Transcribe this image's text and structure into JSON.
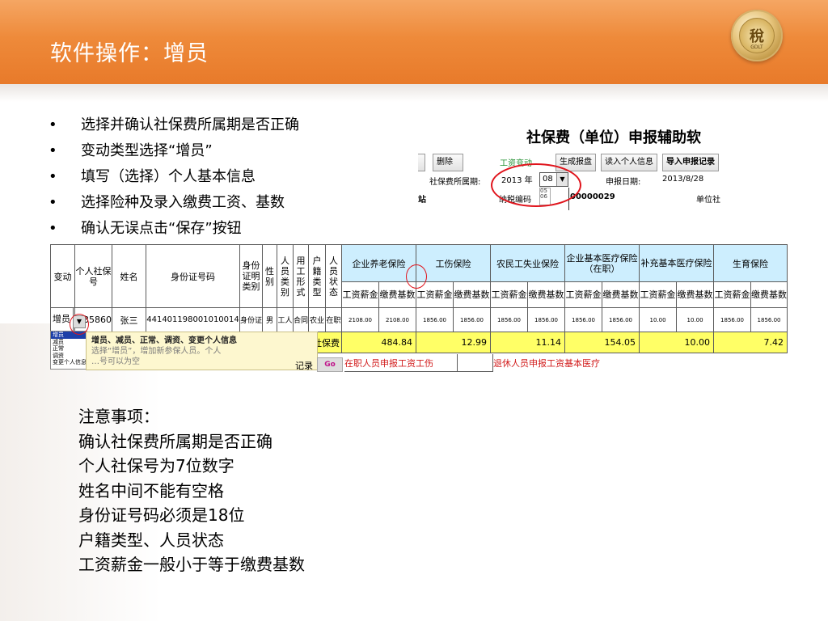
{
  "slide": {
    "title": "软件操作：增员"
  },
  "logo": {
    "glyph": "稅",
    "text": "GDLT"
  },
  "bullets": [
    "选择并确认社保费所属期是否正确",
    "变动类型选择“增员”",
    "填写（选择）个人基本信息",
    "选择险种及录入缴费工资、基数",
    "确认无误点击“保存”按钮"
  ],
  "bullet_marker": "•",
  "form_shot": {
    "title": "社保费（单位）申报辅助软",
    "delete_button": "删除",
    "wage_change": "工资变动",
    "generate_button": "生成报盘",
    "read_button": "读入个人信息",
    "import_button": "导入申报记录",
    "period_label": "社保费所属期:",
    "year": "2013 年",
    "month": "08",
    "month_options": [
      "05",
      "06"
    ],
    "report_date_label": "申报日期:",
    "report_date": "2013/8/28",
    "left_cut": "站",
    "tax_code_label": "纳税编码",
    "tax_code_value": "00000029",
    "unit_label": "单位社"
  },
  "table": {
    "headers": {
      "change": "变动",
      "personal_no": "个人社保号",
      "name": "姓名",
      "id_no": "身份证号码",
      "id_type": "身份证明类别",
      "gender": "性别",
      "person_type": "人员类别",
      "employ_form": "用工形式",
      "household_type": "户籍类型",
      "person_status": "人员状态"
    },
    "groups": [
      "企业养老保险",
      "工伤保险",
      "农民工失业保险",
      "企业基本医疗保险（在职）",
      "补充基本医疗保险",
      "生育保险"
    ],
    "sub_headers": [
      "工资薪金",
      "缴费基数"
    ],
    "row": {
      "change": "增员",
      "personal_no": "35860",
      "name": "张三",
      "id_no": "441401198001010014",
      "id_type": "身份证",
      "gender": "男",
      "person_type": "工人",
      "employ_form": "合同",
      "household_type": "农业",
      "person_status": "在职",
      "values": [
        "2108.00",
        "2108.00",
        "1856.00",
        "1856.00",
        "1856.00",
        "1856.00",
        "1856.00",
        "1856.00",
        "10.00",
        "10.00",
        "1856.00",
        "1856.00"
      ]
    },
    "payable_label": "应缴社保费",
    "payable_values": [
      "484.84",
      "12.99",
      "11.14",
      "154.05",
      "10.00",
      "7.42"
    ]
  },
  "dropdown": {
    "options": [
      "增员",
      "减员",
      "正常",
      "调资",
      "变更个人信息"
    ],
    "tooltip_line1_prefix": "增员、减员、正常、调资、变更个人信息",
    "tooltip_line2": "选择“增员”，增加新参保人员。个人",
    "tooltip_line3": "…号可以为空"
  },
  "bottom": {
    "record_label": "记录",
    "go": "Go",
    "red1": "在职人员申报工资工伤",
    "red2": "退休人员申报工资基本医疗"
  },
  "notes": [
    "注意事项：",
    "确认社保费所属期是否正确",
    "个人社保号为7位数字",
    "姓名中间不能有空格",
    "身份证号码必须是18位",
    "户籍类型、人员状态",
    "工资薪金一般小于等于缴费基数"
  ]
}
